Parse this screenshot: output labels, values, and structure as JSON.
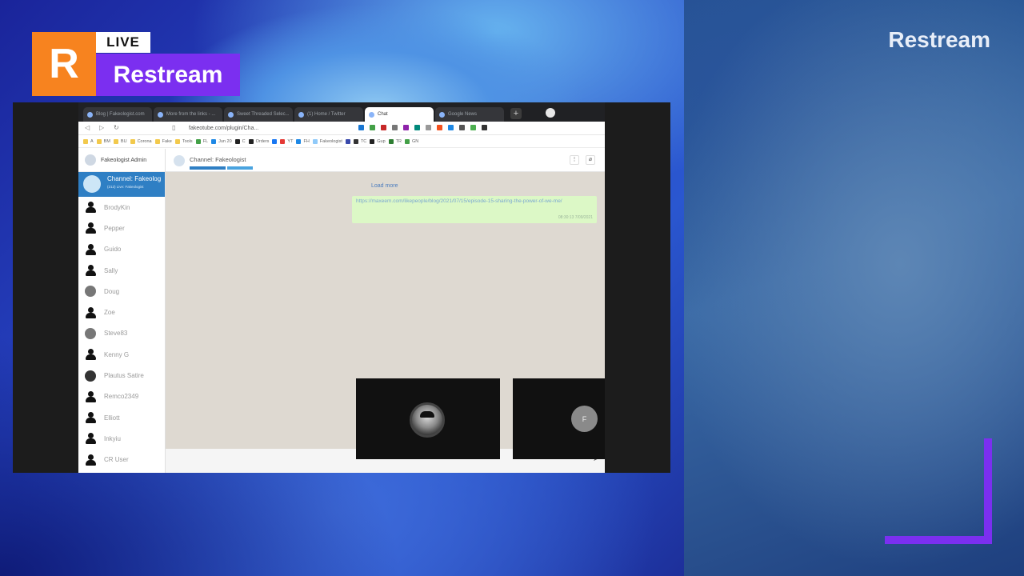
{
  "branding": {
    "logo_letter": "R",
    "live_label": "LIVE",
    "name": "Restream",
    "right_name": "Restream",
    "colors": {
      "orange": "#f7831f",
      "purple": "#7b2ff0"
    }
  },
  "browser": {
    "tabs": [
      {
        "label": "Blog | Fakeologist.com",
        "active": false
      },
      {
        "label": "More from the links - ...",
        "active": false
      },
      {
        "label": "Sweet Threaded Selec...",
        "active": false
      },
      {
        "label": "(1) Home / Twitter",
        "active": false
      },
      {
        "label": "Chat",
        "active": true
      },
      {
        "label": "Google News",
        "active": false
      }
    ],
    "new_tab_label": "+",
    "url": "fakeotube.com/plugin/Cha...",
    "bookmarks": [
      "A",
      "BM",
      "BU",
      "Corona",
      "Fake",
      "Tools",
      "FL",
      "Jun 20",
      "C",
      "Orders",
      "YT",
      "FH",
      "Fakeologist",
      "TC",
      "Gup",
      "TR",
      "GN"
    ]
  },
  "chat": {
    "admin_label": "Fakeologist Admin",
    "channel": {
      "name": "Channel: Fakeolog",
      "sub": "(212) Live: Fakeologist"
    },
    "users": [
      {
        "name": "BrodyKin",
        "avatar": "silhouette"
      },
      {
        "name": "Pepper",
        "avatar": "silhouette"
      },
      {
        "name": "Guido",
        "avatar": "silhouette"
      },
      {
        "name": "Sally",
        "avatar": "silhouette"
      },
      {
        "name": "Doug",
        "avatar": "photo"
      },
      {
        "name": "Zoe",
        "avatar": "silhouette"
      },
      {
        "name": "Steve83",
        "avatar": "photo"
      },
      {
        "name": "Kenny G",
        "avatar": "silhouette"
      },
      {
        "name": "Plautus Satire",
        "avatar": "photo"
      },
      {
        "name": "Remco2349",
        "avatar": "silhouette"
      },
      {
        "name": "Elliott",
        "avatar": "silhouette"
      },
      {
        "name": "Inkyiu",
        "avatar": "silhouette"
      },
      {
        "name": "CR User",
        "avatar": "silhouette"
      }
    ],
    "header_title": "Channel: Fakeologist",
    "load_more": "Load more",
    "message": {
      "text": "https://maxeem.com/likepeople/blog/2021/07/15/episode-15-sharing-the-power-of-we-me/",
      "time": "08:30:13 7/09/2021"
    }
  },
  "participants": {
    "second_initial": "F"
  }
}
